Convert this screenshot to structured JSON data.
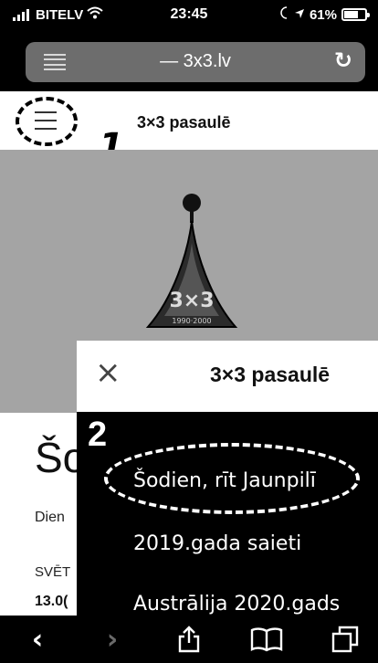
{
  "status_bar": {
    "carrier": "BITELV",
    "time": "23:45",
    "battery": "61%",
    "battery_level": 0.61,
    "icons": [
      "signal-icon",
      "wifi-icon",
      "location-icon",
      "battery-icon"
    ]
  },
  "address_bar": {
    "url_text": "— 3x3.lv",
    "icons": [
      "reader-icon",
      "reload-icon"
    ]
  },
  "page_header": {
    "title": "3×3 pasaulē",
    "icons": [
      "hamburger-menu-icon"
    ]
  },
  "annotations": {
    "step_1": "1",
    "step_2": "2"
  },
  "hero": {
    "logo_name": "3x3-triangle-logo"
  },
  "article": {
    "heading_partial": "Šo",
    "line_1": "Dien",
    "line_2": "SVĒT",
    "line_3": "13.0("
  },
  "drawer": {
    "title": "3×3 pasaulē",
    "close_icon": "close-icon",
    "items": [
      {
        "label": "Šodien, rīt Jaunpilī"
      },
      {
        "label": "2019.gada saieti"
      },
      {
        "label": "Austrālija 2020.gads"
      }
    ]
  },
  "toolbar": {
    "icons": [
      "back-icon",
      "forward-icon",
      "share-icon",
      "bookmarks-icon",
      "tabs-icon"
    ]
  },
  "colors": {
    "address_bar": "#6d6d6d",
    "hero_background": "#a4a4a4",
    "drawer_menu": "#000000"
  }
}
